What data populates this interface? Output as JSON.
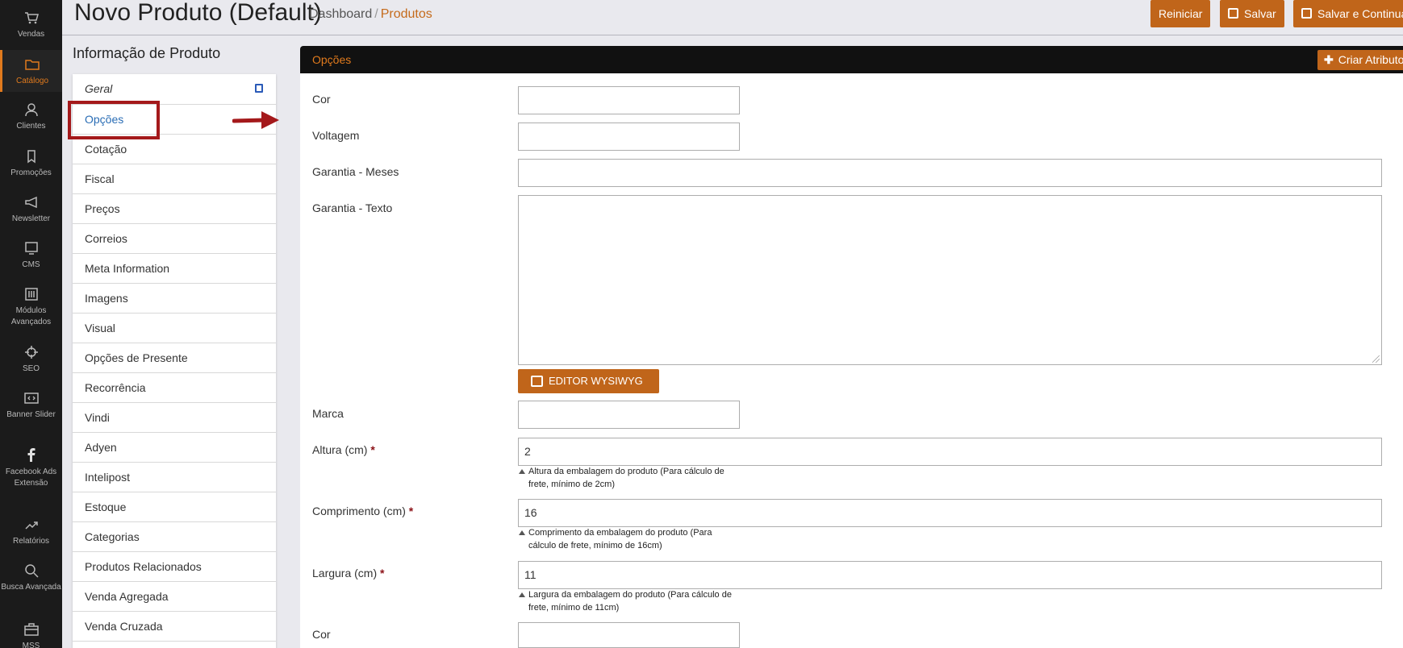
{
  "nav": [
    {
      "label": "Vendas",
      "icon": "cart-icon"
    },
    {
      "label": "Catálogo",
      "icon": "folder-icon",
      "active": true
    },
    {
      "label": "Clientes",
      "icon": "user-icon"
    },
    {
      "label": "Promoções",
      "icon": "tag-icon"
    },
    {
      "label": "Newsletter",
      "icon": "megaphone-icon"
    },
    {
      "label": "CMS",
      "icon": "monitor-icon"
    },
    {
      "label": "Módulos Avançados",
      "icon": "sliders-icon"
    },
    {
      "label": "SEO",
      "icon": "crosshair-icon"
    },
    {
      "label": "Banner Slider",
      "icon": "slider-icon"
    },
    {
      "label": "Facebook Ads Extensão",
      "icon": "facebook-icon"
    },
    {
      "label": "Relatórios",
      "icon": "chart-icon"
    },
    {
      "label": "Busca Avançada",
      "icon": "search-icon"
    },
    {
      "label": "MSS",
      "icon": "briefcase-icon"
    }
  ],
  "header": {
    "title": "Novo Produto (Default)",
    "breadcrumb_home": "Dashboard",
    "breadcrumb_sep": "/",
    "breadcrumb_current": "Produtos",
    "btn_reset": "Reiniciar",
    "btn_save": "Salvar",
    "btn_save_continue": "Salvar e Continuar"
  },
  "panel": {
    "title": "Informação de Produto",
    "tabs": [
      "Geral",
      "Opções",
      "Cotação",
      "Fiscal",
      "Preços",
      "Correios",
      "Meta Information",
      "Imagens",
      "Visual",
      "Opções de Presente",
      "Recorrência",
      "Vindi",
      "Adyen",
      "Intelipost",
      "Estoque",
      "Categorias",
      "Produtos Relacionados",
      "Venda Agregada",
      "Venda Cruzada"
    ],
    "selected_tab": "Opções"
  },
  "main": {
    "section_title": "Opções",
    "create_attribute": "Criar Atributo",
    "wysiwyg_button": "EDITOR WYSIWYG",
    "fields": {
      "cor": {
        "label": "Cor",
        "value": ""
      },
      "voltagem": {
        "label": "Voltagem",
        "value": ""
      },
      "garantia_meses": {
        "label": "Garantia - Meses",
        "value": ""
      },
      "garantia_texto": {
        "label": "Garantia - Texto",
        "value": ""
      },
      "marca": {
        "label": "Marca",
        "value": ""
      },
      "altura": {
        "label": "Altura (cm)",
        "value": "2",
        "hint": "Altura da embalagem do produto (Para cálculo de frete, mínimo de 2cm)"
      },
      "comprimento": {
        "label": "Comprimento (cm)",
        "value": "16",
        "hint": "Comprimento da embalagem do produto (Para cálculo de frete, mínimo de 16cm)"
      },
      "largura": {
        "label": "Largura (cm)",
        "value": "11",
        "hint": "Largura da embalagem do produto (Para cálculo de frete, mínimo de 11cm)"
      },
      "cor2": {
        "label": "Cor",
        "value": ""
      }
    },
    "required_marker": "*"
  },
  "colors": {
    "accent": "#c0651a",
    "nav_bg": "#1b1b1b",
    "highlight": "#a4191b",
    "link": "#2a6db5"
  }
}
